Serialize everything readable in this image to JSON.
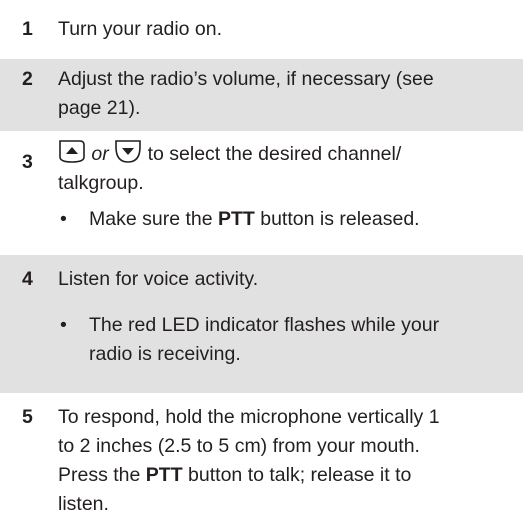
{
  "steps": [
    {
      "number": "1",
      "text": "Turn your radio on."
    },
    {
      "number": "2",
      "line1": "Adjust the radio’s volume, if necessary (see",
      "line2": "page 21)."
    },
    {
      "number": "3",
      "up_icon": "up-arrow-button-icon",
      "or": "or",
      "down_icon": "down-arrow-button-icon",
      "line1_rest": " to select the desired channel/",
      "line2": "talkgroup.",
      "bullet": {
        "pre": "Make sure the ",
        "bold": "PTT",
        "post": " button is released."
      }
    },
    {
      "number": "4",
      "text": "Listen for voice activity.",
      "bullet": {
        "line1": "The red LED indicator flashes while your",
        "line2": "radio is receiving."
      }
    },
    {
      "number": "5",
      "line1": "To respond, hold the microphone vertically 1",
      "line2": "to 2 inches (2.5 to 5 cm) from your mouth.",
      "line3_pre": "Press the ",
      "line3_bold": "PTT",
      "line3_post": " button to talk; release it to",
      "line4": "listen."
    }
  ],
  "bullet_char": "•",
  "colors": {
    "shade": "#e1e1e1",
    "text": "#231f20"
  }
}
